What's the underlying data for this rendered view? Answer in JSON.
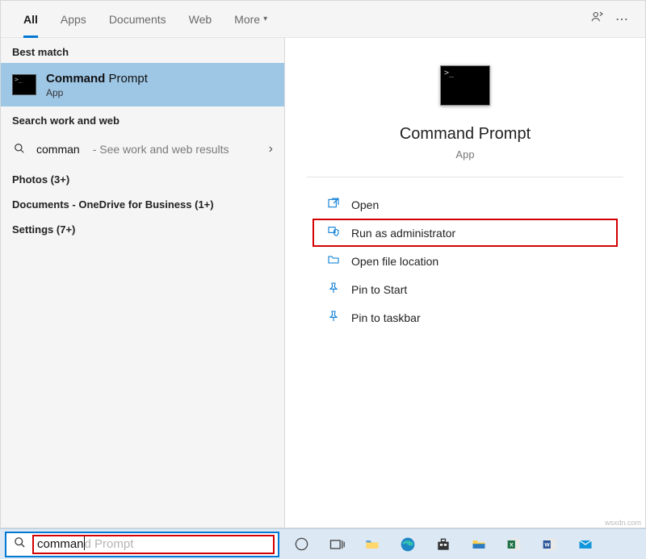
{
  "tabs": {
    "all": "All",
    "apps": "Apps",
    "documents": "Documents",
    "web": "Web",
    "more": "More"
  },
  "sections": {
    "best_match": "Best match",
    "search_work_web": "Search work and web"
  },
  "best_match": {
    "title_bold": "Command",
    "title_rest": " Prompt",
    "subtitle": "App"
  },
  "web": {
    "term": "comman",
    "hint": " - See work and web results"
  },
  "groups": {
    "photos": "Photos (3+)",
    "documents": "Documents - OneDrive for Business (1+)",
    "settings": "Settings (7+)"
  },
  "preview": {
    "title": "Command Prompt",
    "subtitle": "App",
    "actions": {
      "open": "Open",
      "run_admin": "Run as administrator",
      "open_loc": "Open file location",
      "pin_start": "Pin to Start",
      "pin_taskbar": "Pin to taskbar"
    }
  },
  "searchbox": {
    "typed": "comman",
    "ghost": "d Prompt"
  },
  "watermark": "wsxdn.com"
}
